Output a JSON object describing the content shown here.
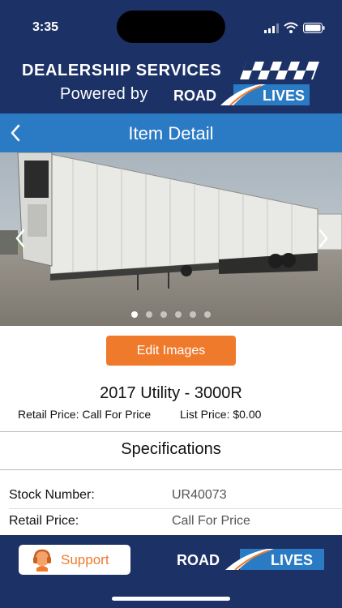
{
  "status_bar": {
    "time": "3:35"
  },
  "brand": {
    "title": "DEALERSHIP SERVICES",
    "powered_by": "Powered by",
    "logo_left": "ROAD",
    "logo_right": "LIVES"
  },
  "nav": {
    "title": "Item Detail",
    "back_icon": "chevron-left-icon"
  },
  "carousel": {
    "image_count": 6,
    "active_index": 0
  },
  "actions": {
    "edit_images": "Edit Images"
  },
  "item": {
    "title": "2017 Utility - 3000R",
    "retail_price": "Retail Price: Call For Price",
    "list_price": "List Price: $0.00"
  },
  "specifications": {
    "heading": "Specifications",
    "rows": [
      {
        "label": "Stock Number:",
        "value": "UR40073"
      },
      {
        "label": "Retail Price:",
        "value": "Call For Price"
      }
    ]
  },
  "footer": {
    "support_label": "Support",
    "logo_left": "ROAD",
    "logo_right": "LIVES"
  },
  "colors": {
    "navy": "#1c3166",
    "nav_blue": "#2a7bc4",
    "orange": "#f07a2c"
  }
}
